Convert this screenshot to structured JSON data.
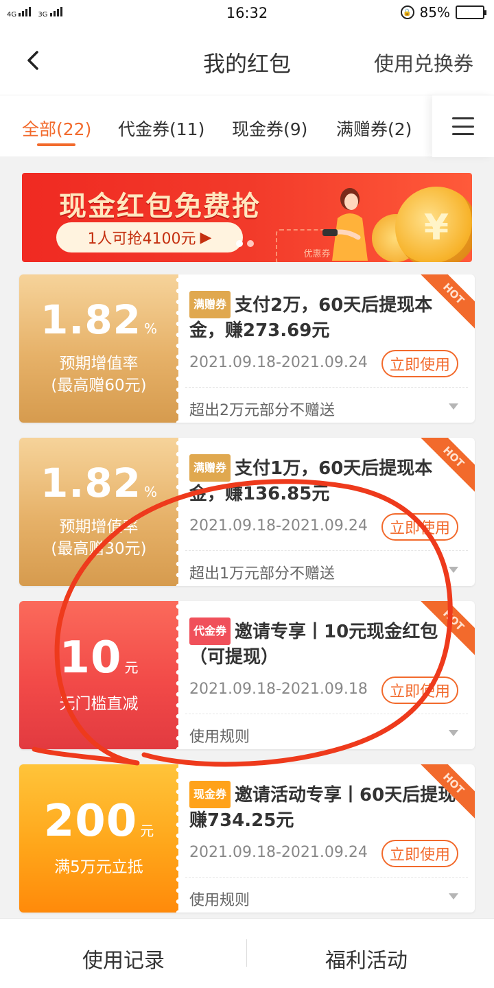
{
  "status_bar": {
    "signal_1": "4G",
    "signal_2": "3G",
    "time": "16:32",
    "battery": "85%",
    "battery_level": 0.85
  },
  "header": {
    "title": "我的红包",
    "action": "使用兑换券"
  },
  "tabs": [
    {
      "label": "全部(22)",
      "active": true
    },
    {
      "label": "代金券(11)",
      "active": false
    },
    {
      "label": "现金券(9)",
      "active": false
    },
    {
      "label": "满赠券(2)",
      "active": false
    }
  ],
  "banner": {
    "title": "现金红包免费抢",
    "pill": "1人可抢4100元",
    "ticket_text": "优惠券",
    "coin_symbol": "¥",
    "page_count": 2,
    "active_page": 1
  },
  "coupons": [
    {
      "theme": "gold",
      "amount": "1.82",
      "unit": "%",
      "cond_1": "预期增值率",
      "cond_2": "(最高赠60元)",
      "tag": "满赠券",
      "title": "支付2万，60天后提现本金，赚273.69元",
      "date": "2021.09.18-2021.09.24",
      "button": "立即使用",
      "note": "超出2万元部分不赠送",
      "badge": "HOT"
    },
    {
      "theme": "gold",
      "amount": "1.82",
      "unit": "%",
      "cond_1": "预期增值率",
      "cond_2": "(最高赠30元)",
      "tag": "满赠券",
      "title": "支付1万，60天后提现本金，赚136.85元",
      "date": "2021.09.18-2021.09.24",
      "button": "立即使用",
      "note": "超出1万元部分不赠送",
      "badge": "HOT"
    },
    {
      "theme": "red",
      "amount": "10",
      "unit": "元",
      "cond_1": "无门槛直减",
      "cond_2": "",
      "tag": "代金券",
      "title": "邀请专享丨10元现金红包（可提现）",
      "date": "2021.09.18-2021.09.18",
      "button": "立即使用",
      "note": "使用规则",
      "badge": "HOT"
    },
    {
      "theme": "orange",
      "amount": "200",
      "unit": "元",
      "cond_1": "满5万元立抵",
      "cond_2": "",
      "tag": "现金券",
      "title": "邀请活动专享丨60天后提现赚734.25元",
      "date": "2021.09.18-2021.09.24",
      "button": "立即使用",
      "note": "使用规则",
      "badge": "HOT"
    }
  ],
  "bottom_bar": {
    "left": "使用记录",
    "right": "福利活动"
  },
  "colors": {
    "accent": "#f26a2c",
    "gold": "#e6b168",
    "red": "#f24a48",
    "orange": "#ffa61a",
    "annotation": "#ee3a1c"
  }
}
